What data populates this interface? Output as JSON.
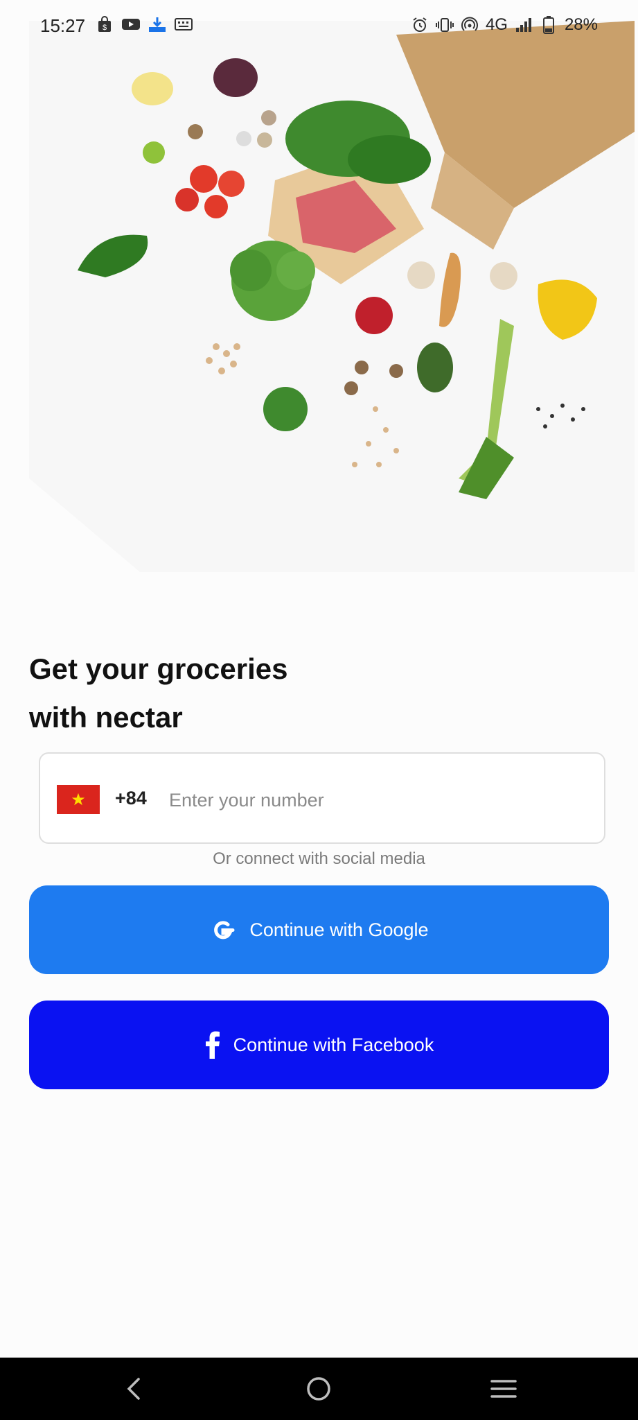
{
  "status_bar": {
    "time": "15:27",
    "network": "4G",
    "battery": "28%",
    "left_icons": [
      "shopping-bag-icon",
      "youtube-icon",
      "download-icon",
      "keyboard-icon"
    ],
    "right_icons": [
      "alarm-icon",
      "vibrate-icon",
      "hotspot-icon",
      "signal-icon",
      "battery-icon"
    ]
  },
  "hero": {
    "image": "groceries-illustration"
  },
  "headline": {
    "line1": "Get your groceries",
    "line2": "with nectar"
  },
  "phone": {
    "country_flag": "vietnam-flag-icon",
    "dial_code": "+84",
    "value": "",
    "placeholder": "Enter your number"
  },
  "social": {
    "caption": "Or connect with social media",
    "google_label": "Continue with Google",
    "facebook_label": "Continue with Facebook"
  },
  "colors": {
    "google_button": "#1e7bf0",
    "facebook_button": "#0a12f2",
    "flag_red": "#da251d",
    "flag_star": "#ffde00"
  },
  "nav_bar": {
    "items": [
      "back-icon",
      "home-icon",
      "menu-icon"
    ]
  }
}
